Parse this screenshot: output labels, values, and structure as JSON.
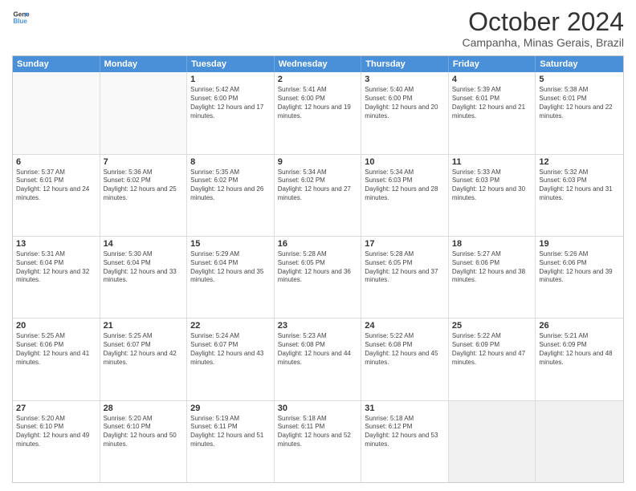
{
  "header": {
    "logo_line1": "General",
    "logo_line2": "Blue",
    "month_title": "October 2024",
    "location": "Campanha, Minas Gerais, Brazil"
  },
  "days_of_week": [
    "Sunday",
    "Monday",
    "Tuesday",
    "Wednesday",
    "Thursday",
    "Friday",
    "Saturday"
  ],
  "rows": [
    [
      {
        "day": "",
        "text": "",
        "empty": true
      },
      {
        "day": "",
        "text": "",
        "empty": true
      },
      {
        "day": "1",
        "text": "Sunrise: 5:42 AM\nSunset: 6:00 PM\nDaylight: 12 hours and 17 minutes."
      },
      {
        "day": "2",
        "text": "Sunrise: 5:41 AM\nSunset: 6:00 PM\nDaylight: 12 hours and 19 minutes."
      },
      {
        "day": "3",
        "text": "Sunrise: 5:40 AM\nSunset: 6:00 PM\nDaylight: 12 hours and 20 minutes."
      },
      {
        "day": "4",
        "text": "Sunrise: 5:39 AM\nSunset: 6:01 PM\nDaylight: 12 hours and 21 minutes."
      },
      {
        "day": "5",
        "text": "Sunrise: 5:38 AM\nSunset: 6:01 PM\nDaylight: 12 hours and 22 minutes."
      }
    ],
    [
      {
        "day": "6",
        "text": "Sunrise: 5:37 AM\nSunset: 6:01 PM\nDaylight: 12 hours and 24 minutes."
      },
      {
        "day": "7",
        "text": "Sunrise: 5:36 AM\nSunset: 6:02 PM\nDaylight: 12 hours and 25 minutes."
      },
      {
        "day": "8",
        "text": "Sunrise: 5:35 AM\nSunset: 6:02 PM\nDaylight: 12 hours and 26 minutes."
      },
      {
        "day": "9",
        "text": "Sunrise: 5:34 AM\nSunset: 6:02 PM\nDaylight: 12 hours and 27 minutes."
      },
      {
        "day": "10",
        "text": "Sunrise: 5:34 AM\nSunset: 6:03 PM\nDaylight: 12 hours and 28 minutes."
      },
      {
        "day": "11",
        "text": "Sunrise: 5:33 AM\nSunset: 6:03 PM\nDaylight: 12 hours and 30 minutes."
      },
      {
        "day": "12",
        "text": "Sunrise: 5:32 AM\nSunset: 6:03 PM\nDaylight: 12 hours and 31 minutes."
      }
    ],
    [
      {
        "day": "13",
        "text": "Sunrise: 5:31 AM\nSunset: 6:04 PM\nDaylight: 12 hours and 32 minutes."
      },
      {
        "day": "14",
        "text": "Sunrise: 5:30 AM\nSunset: 6:04 PM\nDaylight: 12 hours and 33 minutes."
      },
      {
        "day": "15",
        "text": "Sunrise: 5:29 AM\nSunset: 6:04 PM\nDaylight: 12 hours and 35 minutes."
      },
      {
        "day": "16",
        "text": "Sunrise: 5:28 AM\nSunset: 6:05 PM\nDaylight: 12 hours and 36 minutes."
      },
      {
        "day": "17",
        "text": "Sunrise: 5:28 AM\nSunset: 6:05 PM\nDaylight: 12 hours and 37 minutes."
      },
      {
        "day": "18",
        "text": "Sunrise: 5:27 AM\nSunset: 6:06 PM\nDaylight: 12 hours and 38 minutes."
      },
      {
        "day": "19",
        "text": "Sunrise: 5:26 AM\nSunset: 6:06 PM\nDaylight: 12 hours and 39 minutes."
      }
    ],
    [
      {
        "day": "20",
        "text": "Sunrise: 5:25 AM\nSunset: 6:06 PM\nDaylight: 12 hours and 41 minutes."
      },
      {
        "day": "21",
        "text": "Sunrise: 5:25 AM\nSunset: 6:07 PM\nDaylight: 12 hours and 42 minutes."
      },
      {
        "day": "22",
        "text": "Sunrise: 5:24 AM\nSunset: 6:07 PM\nDaylight: 12 hours and 43 minutes."
      },
      {
        "day": "23",
        "text": "Sunrise: 5:23 AM\nSunset: 6:08 PM\nDaylight: 12 hours and 44 minutes."
      },
      {
        "day": "24",
        "text": "Sunrise: 5:22 AM\nSunset: 6:08 PM\nDaylight: 12 hours and 45 minutes."
      },
      {
        "day": "25",
        "text": "Sunrise: 5:22 AM\nSunset: 6:09 PM\nDaylight: 12 hours and 47 minutes."
      },
      {
        "day": "26",
        "text": "Sunrise: 5:21 AM\nSunset: 6:09 PM\nDaylight: 12 hours and 48 minutes."
      }
    ],
    [
      {
        "day": "27",
        "text": "Sunrise: 5:20 AM\nSunset: 6:10 PM\nDaylight: 12 hours and 49 minutes."
      },
      {
        "day": "28",
        "text": "Sunrise: 5:20 AM\nSunset: 6:10 PM\nDaylight: 12 hours and 50 minutes."
      },
      {
        "day": "29",
        "text": "Sunrise: 5:19 AM\nSunset: 6:11 PM\nDaylight: 12 hours and 51 minutes."
      },
      {
        "day": "30",
        "text": "Sunrise: 5:18 AM\nSunset: 6:11 PM\nDaylight: 12 hours and 52 minutes."
      },
      {
        "day": "31",
        "text": "Sunrise: 5:18 AM\nSunset: 6:12 PM\nDaylight: 12 hours and 53 minutes."
      },
      {
        "day": "",
        "text": "",
        "empty": true,
        "shaded": true
      },
      {
        "day": "",
        "text": "",
        "empty": true,
        "shaded": true
      }
    ]
  ]
}
